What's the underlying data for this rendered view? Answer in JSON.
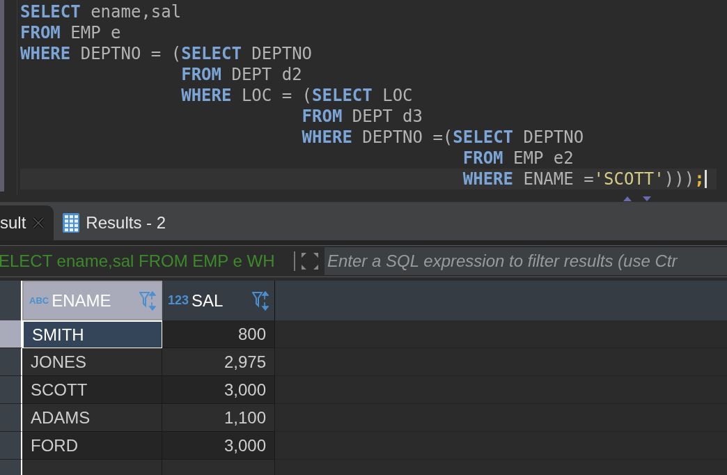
{
  "editor": {
    "lines": [
      {
        "current": false,
        "tokens": [
          {
            "kind": "keyword",
            "text": "SELECT"
          },
          {
            "kind": "plain",
            "text": " ename,sal"
          }
        ]
      },
      {
        "current": false,
        "tokens": [
          {
            "kind": "keyword",
            "text": "FROM"
          },
          {
            "kind": "plain",
            "text": " EMP e"
          }
        ]
      },
      {
        "current": false,
        "tokens": [
          {
            "kind": "keyword",
            "text": "WHERE"
          },
          {
            "kind": "plain",
            "text": " DEPTNO = ("
          },
          {
            "kind": "keyword",
            "text": "SELECT"
          },
          {
            "kind": "plain",
            "text": " DEPTNO"
          }
        ]
      },
      {
        "current": false,
        "tokens": [
          {
            "kind": "keyword",
            "text": "                FROM"
          },
          {
            "kind": "plain",
            "text": " DEPT d2"
          }
        ]
      },
      {
        "current": false,
        "tokens": [
          {
            "kind": "keyword",
            "text": "                WHERE"
          },
          {
            "kind": "plain",
            "text": " LOC = ("
          },
          {
            "kind": "keyword",
            "text": "SELECT"
          },
          {
            "kind": "plain",
            "text": " LOC"
          }
        ]
      },
      {
        "current": false,
        "tokens": [
          {
            "kind": "keyword",
            "text": "                            FROM"
          },
          {
            "kind": "plain",
            "text": " DEPT d3"
          }
        ]
      },
      {
        "current": false,
        "tokens": [
          {
            "kind": "keyword",
            "text": "                            WHERE"
          },
          {
            "kind": "plain",
            "text": " DEPTNO =("
          },
          {
            "kind": "keyword",
            "text": "SELECT"
          },
          {
            "kind": "plain",
            "text": " DEPTNO"
          }
        ]
      },
      {
        "current": false,
        "tokens": [
          {
            "kind": "keyword",
            "text": "                                            FROM"
          },
          {
            "kind": "plain",
            "text": " EMP e2"
          }
        ]
      },
      {
        "current": true,
        "tokens": [
          {
            "kind": "keyword",
            "text": "                                            WHERE"
          },
          {
            "kind": "plain",
            "text": " ENAME ="
          },
          {
            "kind": "string",
            "text": "'SCOTT'"
          },
          {
            "kind": "plain",
            "text": ")))"
          },
          {
            "kind": "punct",
            "text": ";"
          }
        ]
      }
    ]
  },
  "tabs": [
    {
      "label": "sult",
      "selected": true,
      "closable": true
    },
    {
      "label": "Results - 2",
      "selected": false,
      "closable": false
    }
  ],
  "filter": {
    "query": "ELECT ename,sal FROM EMP e WH",
    "placeholder": "Enter a SQL expression to filter results (use Ctr"
  },
  "table": {
    "columns": [
      {
        "type_badge": "ABC",
        "name": "ENAME",
        "kind": "text",
        "selected": true
      },
      {
        "type_badge": "123",
        "name": "SAL",
        "kind": "number",
        "selected": false
      }
    ],
    "rows": [
      {
        "selected": true,
        "cells": [
          "SMITH",
          "800"
        ]
      },
      {
        "selected": false,
        "cells": [
          "JONES",
          "2,975"
        ]
      },
      {
        "selected": false,
        "cells": [
          "SCOTT",
          "3,000"
        ]
      },
      {
        "selected": false,
        "cells": [
          "ADAMS",
          "1,100"
        ]
      },
      {
        "selected": false,
        "cells": [
          "FORD",
          "3,000"
        ]
      }
    ]
  }
}
